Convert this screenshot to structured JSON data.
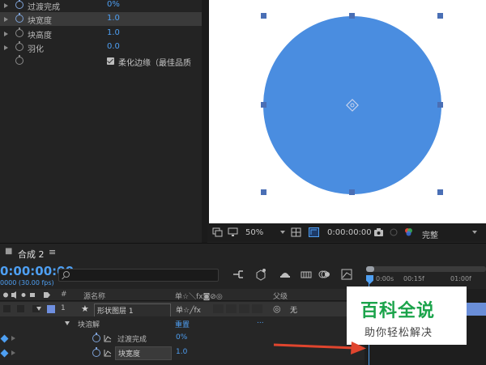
{
  "effects": {
    "properties": [
      {
        "label": "过渡完成",
        "value": "0%"
      },
      {
        "label": "块宽度",
        "value": "1.0"
      },
      {
        "label": "块高度",
        "value": "1.0"
      },
      {
        "label": "羽化",
        "value": "0.0"
      }
    ],
    "soft_edges_label": "柔化边缘（最佳品质"
  },
  "viewer": {
    "shape_color": "#4a8de0",
    "background_color": "#ffffff",
    "zoom": "50%",
    "timecode": "0:00:00:00",
    "quality": "完整"
  },
  "timeline": {
    "tab_label": "合成 2",
    "tab_menu": "≡",
    "timecode": "0:00:00:00",
    "fps": "0000 (30.00 fps)",
    "search_placeholder": "ρ▾",
    "ruler_labels": [
      "0:00s",
      "00:15f",
      "01:00f"
    ],
    "header": {
      "num": "#",
      "source_name": "源名称",
      "switches": "单☆＼fx◙⊘◎",
      "parent": "父级"
    },
    "layer": {
      "index": "1",
      "name": "形状图层 1",
      "parent": "无"
    },
    "effect": {
      "name": "块溶解",
      "reset": "重置",
      "dots": "..."
    },
    "props": [
      {
        "label": "过渡完成",
        "value": "0%"
      },
      {
        "label": "块宽度",
        "value": "1.0"
      }
    ]
  },
  "watermark": {
    "title": "百科全说",
    "subtitle": "助你轻松解决"
  },
  "colors": {
    "accent": "#4e9ff2",
    "panel": "#232323",
    "watermark_green": "#1aa34a",
    "arrow": "#e0452e"
  }
}
